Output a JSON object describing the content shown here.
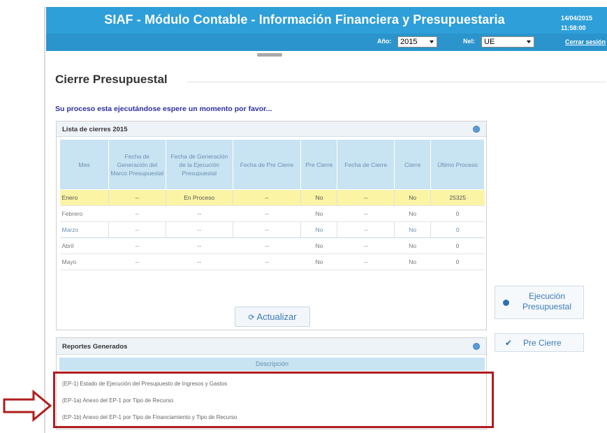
{
  "header": {
    "title": "SIAF - Módulo Contable - Información Financiera y Presupuestaria",
    "date": "14/04/2015",
    "time": "11:58:00",
    "year_label": "Año:",
    "year_value": "2015",
    "nivel_label": "Nel:",
    "nivel_value": "UE",
    "logout": "Cerrar sesión"
  },
  "page": {
    "title": "Cierre Presupuestal",
    "processing_msg": "Su proceso esta ejecutándose espere un momento por favor..."
  },
  "cierres": {
    "title": "Lista de cierres 2015",
    "columns": [
      "Mes",
      "Fecha de Generación del Marco Presupuestal",
      "Fecha de Generación de la Ejecución Presupuestal",
      "Fecha de Pre Cierre",
      "Pre Cierre",
      "Fecha de Cierre",
      "Cierre",
      "Último Proceso"
    ],
    "rows": [
      [
        "Enero",
        "--",
        "En Proceso",
        "--",
        "No",
        "--",
        "No",
        "25325"
      ],
      [
        "Febrero",
        "--",
        "--",
        "--",
        "No",
        "--",
        "No",
        "0"
      ],
      [
        "Marzo",
        "--",
        "--",
        "--",
        "No",
        "--",
        "No",
        "0"
      ],
      [
        "Abril",
        "--",
        "--",
        "--",
        "No",
        "--",
        "No",
        "0"
      ],
      [
        "Mayo",
        "--",
        "--",
        "--",
        "No",
        "--",
        "No",
        "0"
      ]
    ],
    "refresh_label": "Actualizar"
  },
  "side": {
    "exec_label_1": "Ejecución",
    "exec_label_2": "Presupuestal",
    "precierre_label": "Pre Cierre"
  },
  "reportes": {
    "title": "Reportes Generados",
    "column": "Descripción",
    "items": [
      "(EP-1) Estado de Ejecución del Presupuesto de Ingresos y Gastos",
      "(EP-1a) Anexo del EP-1 por Tipo de Recurso",
      "(EP-1b) Anexo del EP-1 por Tipo de Financiamiento y Tipo de Recurso"
    ]
  },
  "colors": {
    "header_blue": "#2e9fd9",
    "highlight_red": "#b01e1e",
    "selected_row": "#fbf4a5"
  }
}
